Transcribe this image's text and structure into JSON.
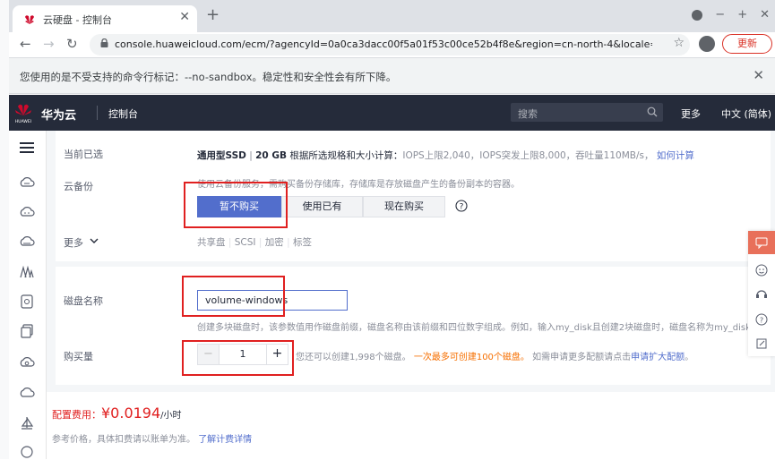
{
  "browser": {
    "tab_title": "云硬盘 - 控制台",
    "url": "console.huaweicloud.com/ecm/?agencyId=0a0ca3dacc00f5a01f53c00ce52b4f8e&region=cn-north-4&locale=zh…",
    "update_label": "更新",
    "infobar_message": "您使用的是不受支持的命令行标记：--no-sandbox。稳定性和安全性会有所下降。"
  },
  "header": {
    "logo_text": "HUAWEI",
    "brand": "华为云",
    "console": "控制台",
    "search_placeholder": "搜索",
    "more": "更多",
    "language": "中文 (简体)"
  },
  "form": {
    "current_selection_label": "当前已选",
    "current_selection": {
      "type": "通用型SSD",
      "size": "20 GB",
      "note": "根据所选规格和大小计算：",
      "perf": "IOPS上限2,040，IOPS突发上限8,000，吞吐量110MB/s，",
      "link": "如何计算"
    },
    "backup_label": "云备份",
    "backup_desc": "使用云备份服务，需购买备份存储库，存储库是存放磁盘产生的备份副本的容器。",
    "backup_options": [
      "暂不购买",
      "使用已有",
      "现在购买"
    ],
    "backup_help": "?",
    "more_label": "更多",
    "more_items": [
      "共享盘",
      "SCSI",
      "加密",
      "标签"
    ],
    "more_sep": "|",
    "disk_name_label": "磁盘名称",
    "disk_name_value": "volume-windows",
    "disk_name_hint": "创建多块磁盘时，该参数值用作磁盘前缀，磁盘名称由该前缀和四位数字组成。例如，输入my_disk且创建2块磁盘时，磁盘名称为my_disk",
    "quantity_label": "购买量",
    "quantity_value": "1",
    "quantity_minus": "−",
    "quantity_plus": "+",
    "quantity_hint1": "您还可以创建1,998个磁盘。",
    "quantity_hint2": "一次最多可创建100个磁盘。",
    "quantity_hint3": "如需申请更多配额请点击",
    "quantity_link": "申请扩大配额",
    "quantity_hint_end": "。"
  },
  "footer": {
    "price_label": "配置费用：",
    "price_value": "¥0.0194",
    "price_unit": "/小时",
    "price_note": "参考价格，具体扣费请以账单为准。",
    "price_link": "了解计费详情"
  },
  "colors": {
    "accent": "#526ecc",
    "price": "#e02020",
    "highlight": "#e02020",
    "header_bg": "#252b3a"
  }
}
